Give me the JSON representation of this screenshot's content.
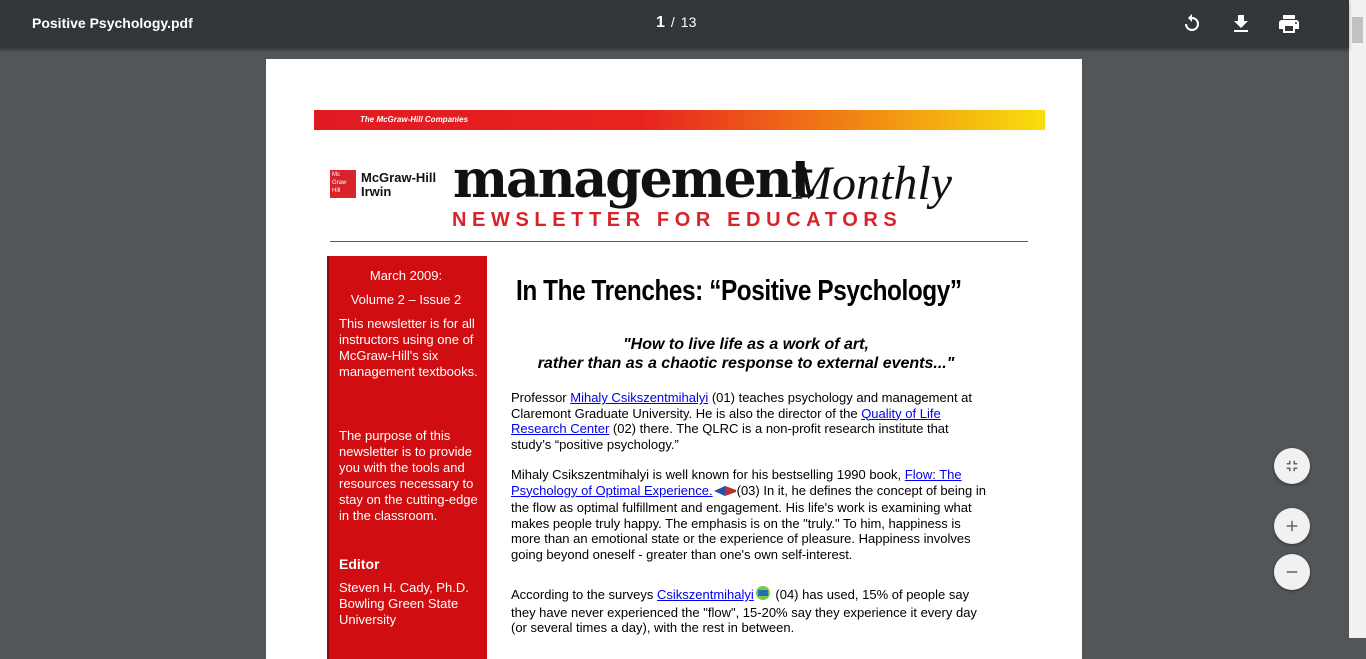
{
  "toolbar": {
    "title": "Positive Psychology.pdf",
    "current_page": "1",
    "separator": "/",
    "total_pages": "13",
    "icons": [
      "rotate-icon",
      "download-icon",
      "print-icon"
    ]
  },
  "page": {
    "banner_text": "The McGraw-Hill Companies",
    "logo_text": "Mc Graw Hill",
    "brand_line1": "McGraw-Hill",
    "brand_line2": "Irwin",
    "masthead_word": "management",
    "masthead_italic": "Monthly",
    "subtitle": "NEWSLETTER FOR EDUCATORS",
    "sidebar": {
      "date": "March 2009:",
      "volume": "Volume 2 – Issue 2",
      "intro": "This newsletter is for all instructors using one of McGraw-Hill's six management textbooks.",
      "purpose": "The purpose of this newsletter is to provide you with the tools and resources necessary to stay on the cutting-edge in the classroom.",
      "editor_heading": "Editor",
      "editor_name": "Steven H. Cady, Ph.D.",
      "editor_affil": "Bowling Green State University"
    },
    "headline": "In The Trenches: “Positive Psychology”",
    "quote_line1": "\"How to live life as a work of art,",
    "quote_line2": "rather than as a chaotic response to external events...\"",
    "p1": {
      "t1": "Professor ",
      "link1": "Mihaly Csikszentmihalyi",
      "t2": " (01) teaches psychology and management at Claremont Graduate University.  He is also the director of the ",
      "link2": "Quality of Life Research Center",
      "t3": " (02) there.  The QLRC is a non-profit research institute that study’s “positive psychology.”"
    },
    "p2": {
      "t1": "Mihaly Csikszentmihalyi is well known for his bestselling 1990 book, ",
      "link1": "Flow: The Psychology of Optimal Experience.",
      "t2": "(03)   In it, he defines the concept of being in the flow as optimal fulfillment and engagement.  His life's work is examining what makes people truly happy.  The emphasis is on the \"truly.\"  To him, happiness is more than an emotional state or the experience of pleasure. Happiness involves going beyond oneself - greater than one's own self-interest."
    },
    "p3": {
      "t1": "According to the surveys ",
      "link1": "Csikszentmihalyi",
      "t2": " (04)  has used, 15% of people say they have never experienced the \"flow\", 15-20% say they experience it every day (or several times a day), with the rest in between."
    }
  },
  "controls": [
    "fit-page-icon",
    "zoom-in-icon",
    "zoom-out-icon"
  ]
}
